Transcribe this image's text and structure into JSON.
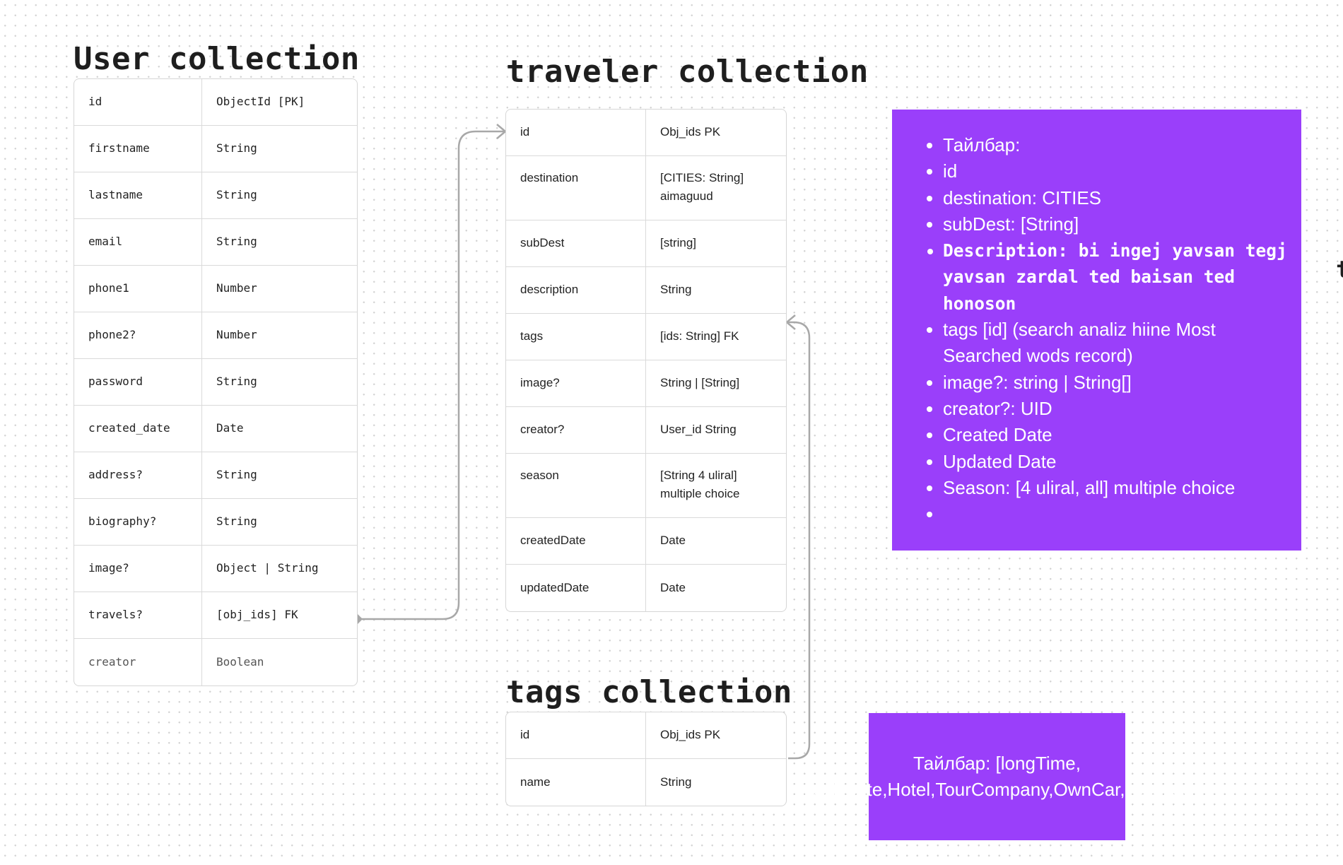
{
  "user_collection": {
    "title": "User collection",
    "rows": [
      {
        "key": "id",
        "value": "ObjectId [PK]"
      },
      {
        "key": "firstname",
        "value": "String"
      },
      {
        "key": "lastname",
        "value": "String"
      },
      {
        "key": "email",
        "value": "String"
      },
      {
        "key": "phone1",
        "value": "Number"
      },
      {
        "key": "phone2?",
        "value": "Number"
      },
      {
        "key": "password",
        "value": "String"
      },
      {
        "key": "created_date",
        "value": "Date"
      },
      {
        "key": "address?",
        "value": "String"
      },
      {
        "key": "biography?",
        "value": "String"
      },
      {
        "key": "image?",
        "value": "Object | String"
      },
      {
        "key": "travels?",
        "value": "[obj_ids] FK"
      },
      {
        "key": "creator",
        "value": "Boolean"
      }
    ]
  },
  "traveler_collection": {
    "title": "traveler collection",
    "rows": [
      {
        "key": "id",
        "value": "Obj_ids PK"
      },
      {
        "key": "destination",
        "value": "[CITIES: String]\naimaguud"
      },
      {
        "key": "subDest",
        "value": "[string]"
      },
      {
        "key": "description",
        "value": "String"
      },
      {
        "key": "tags",
        "value": "[ids: String] FK"
      },
      {
        "key": "image?",
        "value": "String | [String]"
      },
      {
        "key": "creator?",
        "value": "User_id String"
      },
      {
        "key": "season",
        "value": "[String 4 uliral]\nmultiple choice"
      },
      {
        "key": "createdDate",
        "value": "Date"
      },
      {
        "key": "updatedDate",
        "value": "Date"
      }
    ]
  },
  "tags_collection": {
    "title": "tags collection",
    "rows": [
      {
        "key": "id",
        "value": "Obj_ids PK"
      },
      {
        "key": "name",
        "value": "String"
      }
    ]
  },
  "note_traveler": {
    "items": [
      "Тайлбар:",
      "id",
      "destination: CITIES",
      "subDest: [String]",
      "Description: bi ingej yavsan tegj yavsan zardal ted baisan ted honoson",
      "tags [id] (search analiz hiine Most Searched wods record)",
      "image?: string | String[]",
      "creator?: UID",
      "Created Date",
      "Updated Date",
      "Season: [4 uliral, all] multiple choice",
      ""
    ]
  },
  "note_tags": {
    "text": "Тайлбар: [longTime, fastRoute,Hotel,TourCompany,OwnCar,Nature,]"
  },
  "edge_glyph": "t",
  "colors": {
    "note_bg": "#9a3ffa",
    "connector": "#a8a8a8",
    "table_border": "#d6d6d6"
  }
}
